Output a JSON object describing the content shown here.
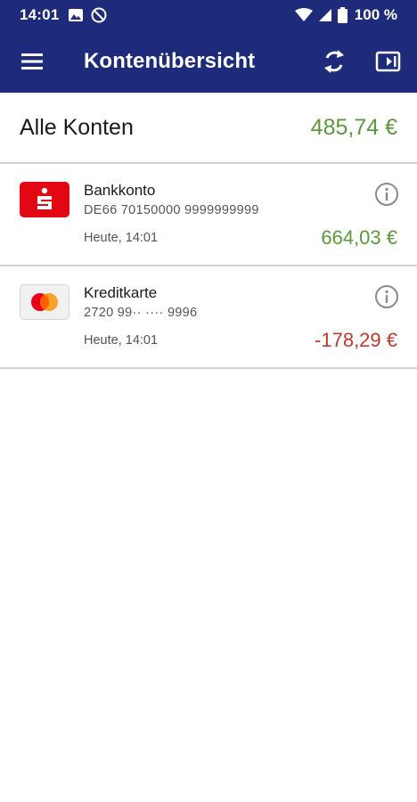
{
  "status_bar": {
    "time": "14:01",
    "battery": "100 %",
    "icons": [
      "image-icon",
      "dnd-icon",
      "wifi-icon",
      "signal-icon",
      "battery-icon"
    ]
  },
  "app_bar": {
    "title": "Kontenübersicht",
    "icons": [
      "menu-icon",
      "sync-icon",
      "logout-icon"
    ],
    "color": "#1d2b7a"
  },
  "summary": {
    "label": "Alle Konten",
    "amount": "485,74 €"
  },
  "accounts": [
    {
      "name": "Bankkonto",
      "number": "DE66 70150000 9999999999",
      "date": "Heute, 14:01",
      "balance": "664,03 €",
      "logo": "sparkasse-logo",
      "balance_color": "#5b9a3a"
    },
    {
      "name": "Kreditkarte",
      "number": "2720 99·· ···· 9996",
      "date": "Heute, 14:01",
      "balance": "-178,29 €",
      "logo": "mastercard-logo",
      "balance_color": "#c0392b"
    }
  ]
}
